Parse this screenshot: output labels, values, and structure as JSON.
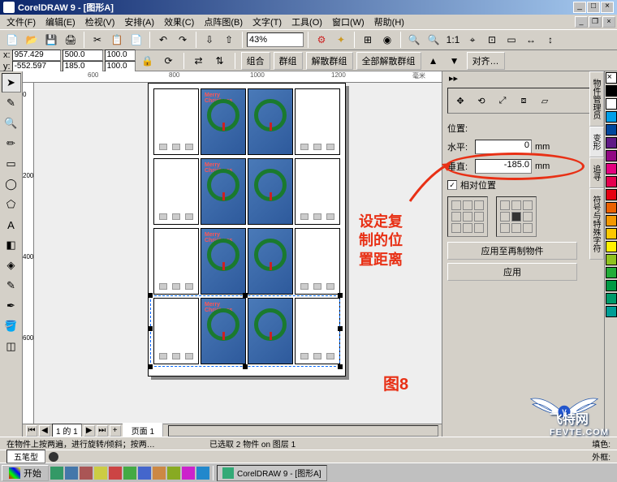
{
  "title": "CorelDRAW 9 - [图形A]",
  "menu": [
    "文件(F)",
    "编辑(E)",
    "检视(V)",
    "安排(A)",
    "效果(C)",
    "点阵图(B)",
    "文字(T)",
    "工具(O)",
    "窗口(W)",
    "帮助(H)"
  ],
  "zoom": "43%",
  "coords": {
    "x_label": "x:",
    "y_label": "y:",
    "x": "957.429",
    "y": "-552.597",
    "w": "500.0 mm",
    "h": "185.0 mm",
    "sx": "100.0",
    "sy": "100.0"
  },
  "propbtns": [
    "组合",
    "群组",
    "解散群组",
    "全部解散群组",
    "对齐…"
  ],
  "ruler_unit": "毫米",
  "ruler_h": [
    "600",
    "800",
    "1000",
    "1200"
  ],
  "ruler_v": [
    "0",
    "200",
    "400",
    "600"
  ],
  "annotation": "设定复\n制的位\n置距离",
  "fig_label": "图8",
  "docker": {
    "pos_label": "位置:",
    "horiz_label": "水平:",
    "horiz_val": "0",
    "vert_label": "垂直:",
    "vert_val": "-185.0",
    "unit": "mm",
    "rel_label": "相对位置",
    "btn1": "应用至再制物件",
    "btn2": "应用",
    "tabs": [
      "物件管理员",
      "变形",
      "追寻",
      "符号与特殊字符"
    ]
  },
  "pagebar": {
    "pageinfo": "1 的 1",
    "pagetab": "页面  1"
  },
  "status1": "在物件上按两遍，进行旋转/倾斜；按两…",
  "status2": "已选取 2 物件 on 图层 1",
  "status_fill": "填色:",
  "status_outline": "外框:",
  "ime": "五笔型",
  "taskbar": {
    "start": "开始",
    "task1": "CorelDRAW 9 - [图形A]"
  },
  "watermark": "飞特网",
  "watermark_url": "FEVTE.COM",
  "colors": [
    "#ffffff",
    "#000000",
    "#00a0e9",
    "#00479d",
    "#601986",
    "#920783",
    "#e4007f",
    "#e5004f",
    "#e60012",
    "#eb6100",
    "#f39800",
    "#fcc800",
    "#fff100",
    "#8fc31f",
    "#22ac38",
    "#009944",
    "#009b6b",
    "#009e96"
  ],
  "card_text": "Merry Christmas"
}
